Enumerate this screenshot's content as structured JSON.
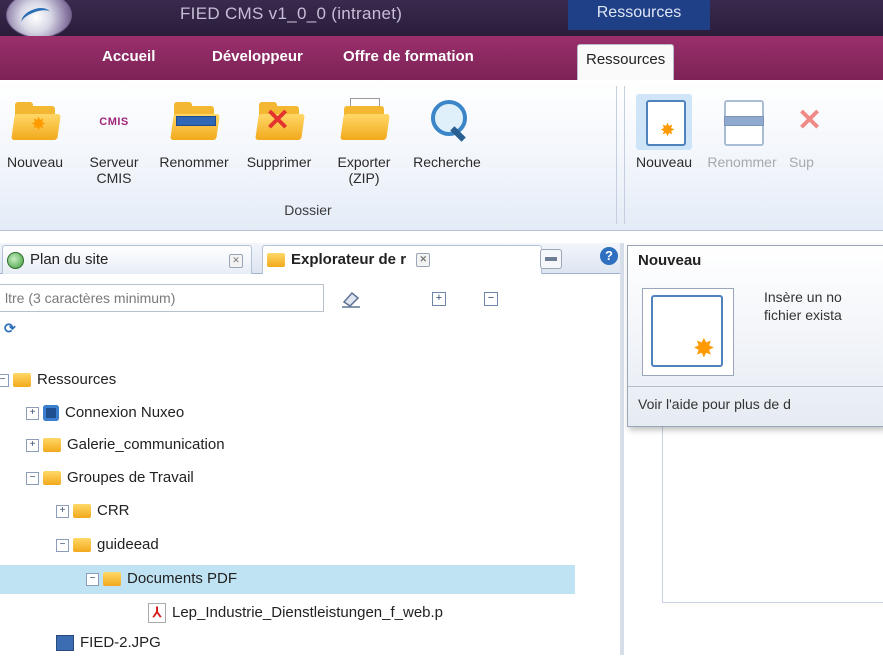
{
  "title_bar": {
    "app_title": "FIED CMS v1_0_0 (intranet)",
    "context_title": "Ressources"
  },
  "ribbon_tabs": [
    "Accueil",
    "Développeur",
    "Offre de formation",
    "Ressources"
  ],
  "ribbon": {
    "dossier_group": {
      "label": "Dossier",
      "buttons": [
        {
          "label": "Nouveau",
          "icon": "new-folder-icon"
        },
        {
          "label": "Serveur CMIS",
          "icon": "cmis-icon",
          "logo_text": "CMIS"
        },
        {
          "label": "Renommer",
          "icon": "rename-folder-icon"
        },
        {
          "label": "Supprimer",
          "icon": "delete-folder-icon"
        },
        {
          "label": "Exporter (ZIP)",
          "icon": "export-zip-icon"
        },
        {
          "label": "Recherche",
          "icon": "search-icon"
        }
      ]
    },
    "fichier_group": {
      "buttons": [
        {
          "label": "Nouveau",
          "icon": "new-file-icon",
          "state": "hover"
        },
        {
          "label": "Renommer",
          "icon": "rename-file-icon",
          "state": "disabled"
        },
        {
          "label": "Sup",
          "icon": "delete-file-icon",
          "state": "disabled"
        }
      ]
    }
  },
  "panel_tabs": [
    {
      "label": "Plan du site",
      "icon": "globe-icon"
    },
    {
      "label": "Explorateur de r",
      "icon": "folder-icon",
      "active": true
    }
  ],
  "filter": {
    "placeholder": "ltre (3 caractères minimum)"
  },
  "tree": {
    "nodes": [
      {
        "label": "Ressources",
        "icon": "folder-icon",
        "expander": "−"
      },
      {
        "label": "Connexion Nuxeo",
        "icon": "nuxeo-icon",
        "expander": "+"
      },
      {
        "label": "Galerie_communication",
        "icon": "folder-icon",
        "expander": "+"
      },
      {
        "label": "Groupes de Travail",
        "icon": "folder-icon",
        "expander": "−"
      },
      {
        "label": "CRR",
        "icon": "folder-icon",
        "expander": "+"
      },
      {
        "label": "guideead",
        "icon": "folder-icon",
        "expander": "−"
      },
      {
        "label": "Documents PDF",
        "icon": "folder-icon",
        "expander": "−",
        "selected": true
      },
      {
        "label": "Lep_Industrie_Dienstleistungen_f_web.p",
        "icon": "pdf-icon"
      },
      {
        "label": "FIED-2.JPG",
        "icon": "image-icon"
      }
    ]
  },
  "tooltip": {
    "title": "Nouveau",
    "line1": "Insère un no",
    "line2": "fichier exista",
    "help": "Voir l'aide pour plus de d"
  },
  "colors": {
    "title_bar": "#2a1d3a",
    "ribbon_tabs_bg": "#8a2860",
    "selected_row": "#bfe3f3",
    "folder": "#f4b732"
  }
}
